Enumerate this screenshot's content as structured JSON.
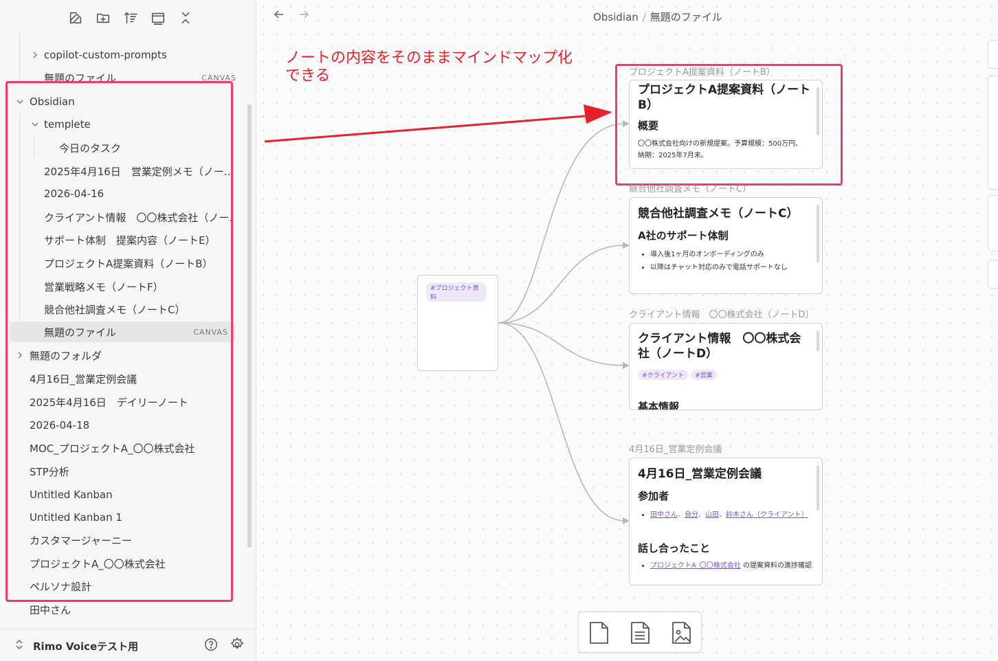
{
  "sidebar": {
    "toolbar_icons": [
      "new-note-icon",
      "new-folder-icon",
      "sort-icon",
      "collapse-view-icon",
      "close-all-icon"
    ],
    "items": [
      {
        "label": "copilot-custom-prompts",
        "badge": ""
      },
      {
        "label": "無題のファイル",
        "badge": "CANVAS"
      },
      {
        "label": "Obsidian",
        "badge": ""
      },
      {
        "label": "templete",
        "badge": ""
      },
      {
        "label": "今日のタスク",
        "badge": ""
      },
      {
        "label": "2025年4月16日　営業定例メモ（ノー...",
        "badge": ""
      },
      {
        "label": "2026-04-16",
        "badge": ""
      },
      {
        "label": "クライアント情報　〇〇株式会社（ノー...",
        "badge": ""
      },
      {
        "label": "サポート体制　提案内容（ノートE）",
        "badge": ""
      },
      {
        "label": "プロジェクトA提案資料（ノートB）",
        "badge": ""
      },
      {
        "label": "営業戦略メモ（ノートF）",
        "badge": ""
      },
      {
        "label": "競合他社調査メモ（ノートC）",
        "badge": ""
      },
      {
        "label": "無題のファイル",
        "badge": "CANVAS"
      },
      {
        "label": "無題のフォルダ",
        "badge": ""
      },
      {
        "label": "4月16日_営業定例会議",
        "badge": ""
      },
      {
        "label": "2025年4月16日　デイリーノート",
        "badge": ""
      },
      {
        "label": "2026-04-18",
        "badge": ""
      },
      {
        "label": "MOC_プロジェクトA_〇〇株式会社",
        "badge": ""
      },
      {
        "label": "STP分析",
        "badge": ""
      },
      {
        "label": "Untitled Kanban",
        "badge": ""
      },
      {
        "label": "Untitled Kanban 1",
        "badge": ""
      },
      {
        "label": "カスタマージャーニー",
        "badge": ""
      },
      {
        "label": "プロジェクトA_〇〇株式会社",
        "badge": ""
      },
      {
        "label": "ペルソナ設計",
        "badge": ""
      },
      {
        "label": "田中さん",
        "badge": ""
      }
    ],
    "vault_name": "Rimo Voiceテスト用"
  },
  "header": {
    "breadcrumb_root": "Obsidian",
    "breadcrumb_sep": "/",
    "breadcrumb_file": "無題のファイル"
  },
  "annotation": {
    "line1": "ノートの内容をそのままマインドマップ化",
    "line2": "できる",
    "color": "#e8202a"
  },
  "canvas": {
    "center_tag": "#プロジェクト資料",
    "cards": {
      "b": {
        "label": "プロジェクトA提案資料（ノートB）",
        "title": "プロジェクトA提案資料（ノートB）",
        "heading": "概要",
        "text": "〇〇株式会社向けの新規提案。予算規模：500万円、納期：2025年7月末。"
      },
      "c": {
        "label": "競合他社調査メモ（ノートC）",
        "title": "競合他社調査メモ（ノートC）",
        "heading": "A社のサポート体制",
        "bullets": [
          "導入後1ヶ月のオンボーディングのみ",
          "以降はチャット対応のみで電話サポートなし"
        ]
      },
      "d": {
        "label": "クライアント情報　〇〇株式会社（ノートD）",
        "title": "クライアント情報　〇〇株式会社（ノートD）",
        "tags": [
          "#クライアント",
          "#営業"
        ],
        "heading": "基本情報"
      },
      "e": {
        "label": "4月16日_営業定例会議",
        "title": "4月16日_営業定例会議",
        "heading1": "参加者",
        "participants": [
          "田中さん",
          "、",
          "自分",
          "、",
          "山田",
          "、",
          "鈴木さん（クライアント）"
        ],
        "heading2": "話し合ったこと",
        "discuss_link": "プロジェクトA_〇〇株式会社",
        "discuss_text": " の提案資料の進捗確認"
      }
    }
  },
  "highlight_color": "#ef3a6e",
  "bottom_toolbar": [
    "add-card-icon",
    "add-note-icon",
    "add-media-icon"
  ]
}
